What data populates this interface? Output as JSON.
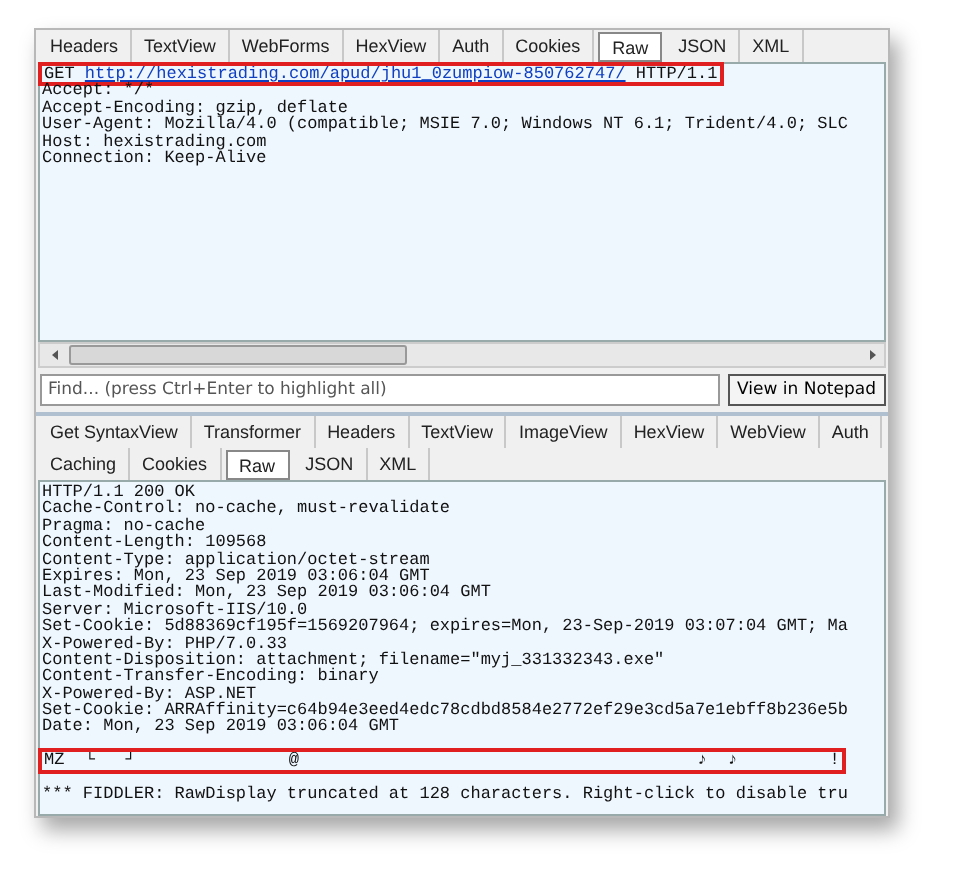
{
  "request_tabs": [
    {
      "label": "Headers",
      "selected": false
    },
    {
      "label": "TextView",
      "selected": false
    },
    {
      "label": "WebForms",
      "selected": false
    },
    {
      "label": "HexView",
      "selected": false
    },
    {
      "label": "Auth",
      "selected": false
    },
    {
      "label": "Cookies",
      "selected": false
    },
    {
      "label": "Raw",
      "selected": true
    },
    {
      "label": "JSON",
      "selected": false
    },
    {
      "label": "XML",
      "selected": false
    }
  ],
  "request": {
    "method": "GET",
    "url": "http://hexistrading.com/apud/jhu1_0zumpiow-850762747/",
    "version": "HTTP/1.1",
    "highlighted": true
  },
  "request_headers": [
    "Accept: */*",
    "Accept-Encoding: gzip, deflate",
    "User-Agent: Mozilla/4.0 (compatible; MSIE 7.0; Windows NT 6.1; Trident/4.0; SLC",
    "Host: hexistrading.com",
    "Connection: Keep-Alive"
  ],
  "find": {
    "placeholder": "Find... (press Ctrl+Enter to highlight all)",
    "button": "View in Notepad"
  },
  "response_tab_rows": [
    [
      {
        "label": "Get SyntaxView",
        "selected": false
      },
      {
        "label": "Transformer",
        "selected": false
      },
      {
        "label": "Headers",
        "selected": false
      },
      {
        "label": "TextView",
        "selected": false
      },
      {
        "label": "ImageView",
        "selected": false
      },
      {
        "label": "HexView",
        "selected": false
      },
      {
        "label": "WebView",
        "selected": false
      },
      {
        "label": "Auth",
        "selected": false
      }
    ],
    [
      {
        "label": "Caching",
        "selected": false
      },
      {
        "label": "Cookies",
        "selected": false
      },
      {
        "label": "Raw",
        "selected": true
      },
      {
        "label": "JSON",
        "selected": false
      },
      {
        "label": "XML",
        "selected": false
      }
    ]
  ],
  "response_lines": [
    "HTTP/1.1 200 OK",
    "Cache-Control: no-cache, must-revalidate",
    "Pragma: no-cache",
    "Content-Length: 109568",
    "Content-Type: application/octet-stream",
    "Expires: Mon, 23 Sep 2019 03:06:04 GMT",
    "Last-Modified: Mon, 23 Sep 2019 03:06:04 GMT",
    "Server: Microsoft-IIS/10.0",
    "Set-Cookie: 5d88369cf195f=1569207964; expires=Mon, 23-Sep-2019 03:07:04 GMT; Ma",
    "X-Powered-By: PHP/7.0.33",
    "Content-Disposition: attachment; filename=\"myj_331332343.exe\"",
    "Content-Transfer-Encoding: binary",
    "X-Powered-By: ASP.NET",
    "Set-Cookie: ARRAffinity=c64b94e3eed4edc78cdbd8584e2772ef29e3cd5a7e1ebff8b236e5b",
    "Date: Mon, 23 Sep 2019 03:06:04 GMT"
  ],
  "body_start": {
    "text": "MZ  └   ┘               @                                       ♪  ♪         !",
    "highlighted": true
  },
  "notice": "*** FIDDLER: RawDisplay truncated at 128 characters. Right-click to disable tru"
}
